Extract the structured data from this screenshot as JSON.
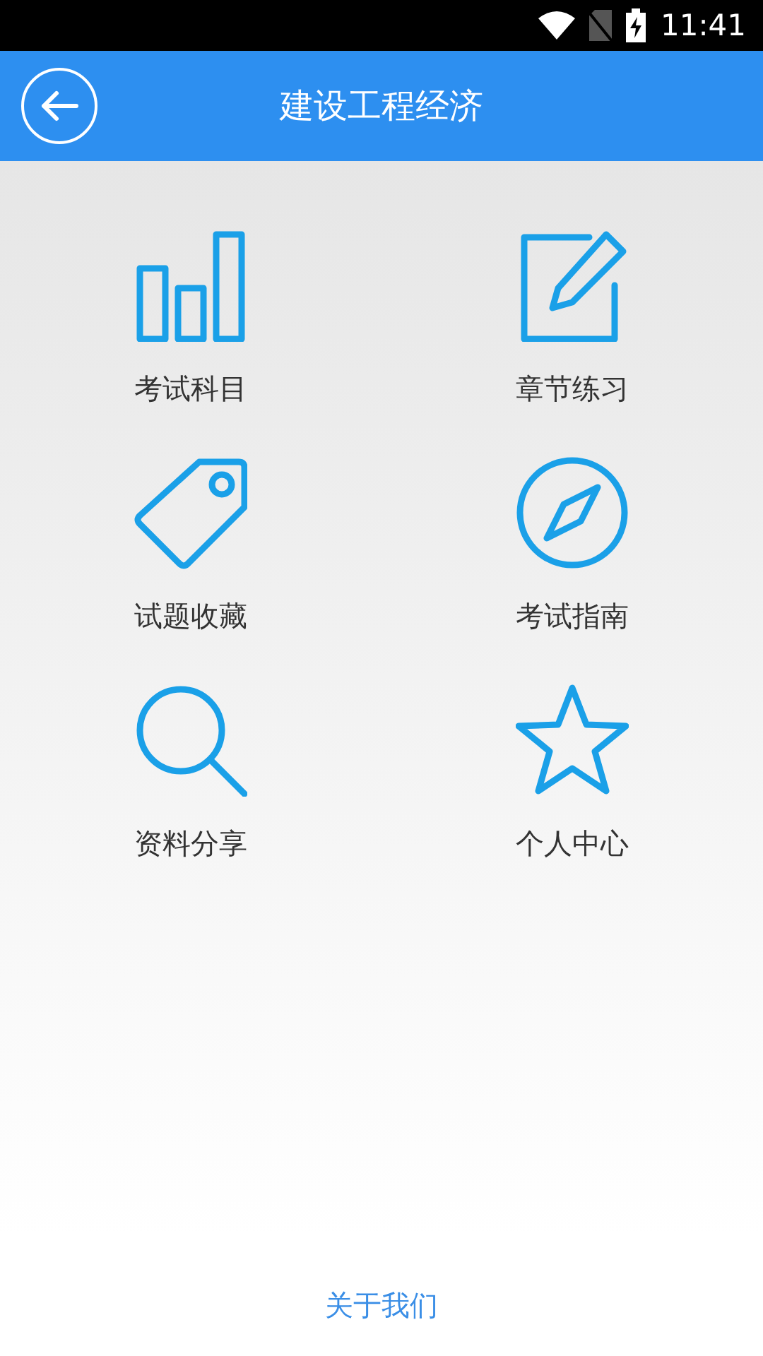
{
  "status_bar": {
    "time": "11:41"
  },
  "header": {
    "title": "建设工程经济"
  },
  "menu": [
    {
      "kind": "bars",
      "label": "考试科目"
    },
    {
      "kind": "edit",
      "label": "章节练习"
    },
    {
      "kind": "tag",
      "label": "试题收藏"
    },
    {
      "kind": "compass",
      "label": "考试指南"
    },
    {
      "kind": "search",
      "label": "资料分享"
    },
    {
      "kind": "star",
      "label": "个人中心"
    }
  ],
  "footer": {
    "link": "关于我们"
  }
}
